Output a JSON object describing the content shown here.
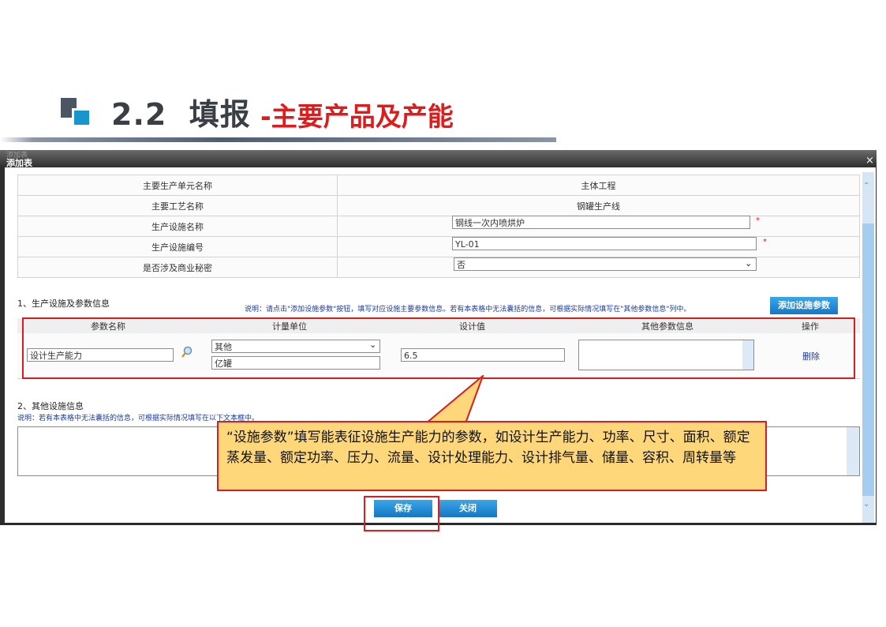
{
  "heading": {
    "number": "2.2",
    "title_black": "填报",
    "title_red": "-主要产品及产能"
  },
  "dialog": {
    "title": "添加表",
    "ghost": "添加表",
    "close": "×"
  },
  "info_rows": [
    {
      "label": "主要生产单元名称",
      "value": "主体工程"
    },
    {
      "label": "主要工艺名称",
      "value": "钢罐生产线"
    },
    {
      "label": "生产设施名称",
      "value": "钢线一次内喷烘炉",
      "required": "*"
    },
    {
      "label": "生产设施编号",
      "value": "YL-01",
      "required": "*"
    },
    {
      "label": "是否涉及商业秘密",
      "value": "否"
    }
  ],
  "section1": {
    "title": "1、生产设施及参数信息",
    "note": "说明：请点击\"添加设施参数\"按钮，填写对应设施主要参数信息。若有本表格中无法囊括的信息，可根据实际情况填写在\"其他参数信息\"列中。",
    "add_button": "添加设施参数",
    "headers": [
      "参数名称",
      "计量单位",
      "设计值",
      "其他参数信息",
      "操作"
    ],
    "row": {
      "param_name": "设计生产能力",
      "unit_select": "其他",
      "unit_text": "亿罐",
      "design_value": "6.5",
      "other_info": "",
      "action": "删除"
    }
  },
  "section2": {
    "title": "2、其他设施信息",
    "note": "说明：若有本表格中无法囊括的信息，可根据实际情况填写在以下文本框中。",
    "text": ""
  },
  "callout": {
    "text": "“设施参数”填写能表征设施生产能力的参数，如设计生产能力、功率、尺寸、面积、额定蒸发量、额定功率、压力、流量、设计处理能力、设计排气量、储量、容积、周转量等"
  },
  "buttons": {
    "save": "保存",
    "close": "关闭"
  },
  "colors": {
    "accent_red": "#e01b1b",
    "button_blue": "#1a86d0",
    "callout_fill": "#fdd77a"
  }
}
